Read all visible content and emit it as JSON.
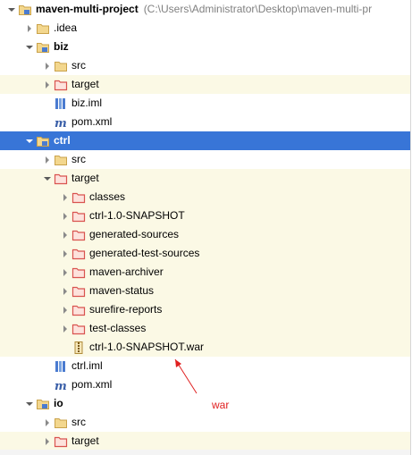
{
  "project": {
    "root_name": "maven-multi-project",
    "root_path": "(C:\\Users\\Administrator\\Desktop\\maven-multi-pr",
    "idea_folder": ".idea"
  },
  "biz": {
    "name": "biz",
    "src": "src",
    "target": "target",
    "iml": "biz.iml",
    "pom": "pom.xml"
  },
  "ctrl": {
    "name": "ctrl",
    "src": "src",
    "target": "target",
    "target_children": [
      "classes",
      "ctrl-1.0-SNAPSHOT",
      "generated-sources",
      "generated-test-sources",
      "maven-archiver",
      "maven-status",
      "surefire-reports",
      "test-classes"
    ],
    "war_file": "ctrl-1.0-SNAPSHOT.war",
    "iml": "ctrl.iml",
    "pom": "pom.xml"
  },
  "io": {
    "name": "io",
    "src": "src",
    "target": "target"
  },
  "annotation": {
    "label": "war",
    "color": "#e02020"
  },
  "colors": {
    "selection": "#3875d7",
    "excluded_bg": "#fbf9e5",
    "folder": "#d9b56b",
    "excluded_folder": "#d9534f"
  }
}
